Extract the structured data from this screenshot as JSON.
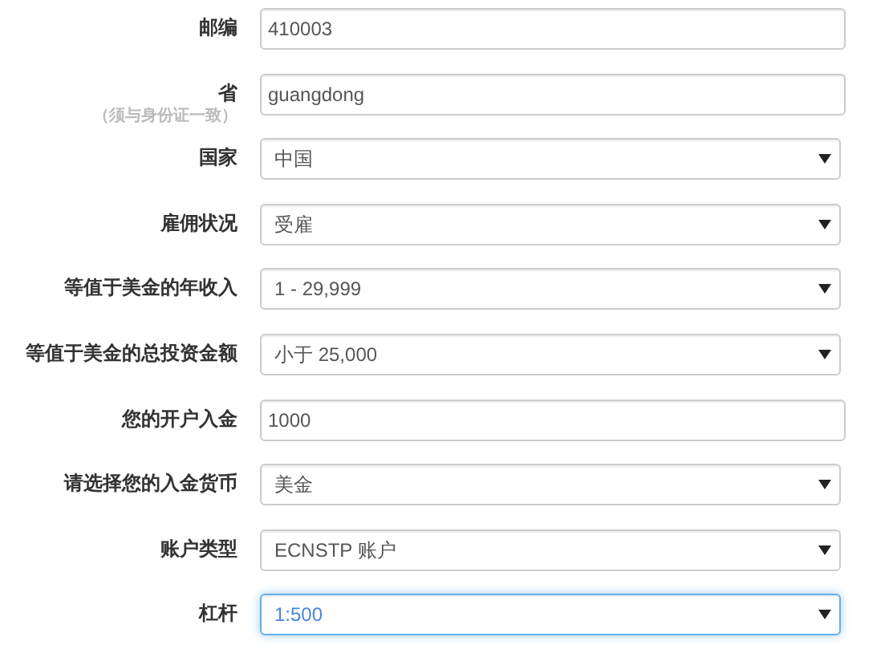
{
  "fields": [
    {
      "label": "邮编",
      "kind": "input",
      "value": "410003",
      "focused": false
    },
    {
      "label": "省",
      "note": "（须与身份证一致）",
      "kind": "input",
      "value": "guangdong",
      "focused": false
    },
    {
      "label": "国家",
      "kind": "select",
      "value": "中国",
      "focused": false
    },
    {
      "label": "雇佣状况",
      "kind": "select",
      "value": "受雇",
      "focused": false
    },
    {
      "label": "等值于美金的年收入",
      "kind": "select",
      "value": "1 - 29,999",
      "focused": false
    },
    {
      "label": "等值于美金的总投资金额",
      "kind": "select",
      "value": "小于 25,000",
      "focused": false
    },
    {
      "label": "您的开户入金",
      "kind": "input",
      "value": "1000",
      "focused": false
    },
    {
      "label": "请选择您的入金货币",
      "kind": "select",
      "value": "美金",
      "focused": false
    },
    {
      "label": "账户类型",
      "kind": "select",
      "value": "ECNSTP 账户",
      "focused": false
    },
    {
      "label": "杠杆",
      "kind": "select",
      "value": "1:500",
      "focused": true
    }
  ]
}
